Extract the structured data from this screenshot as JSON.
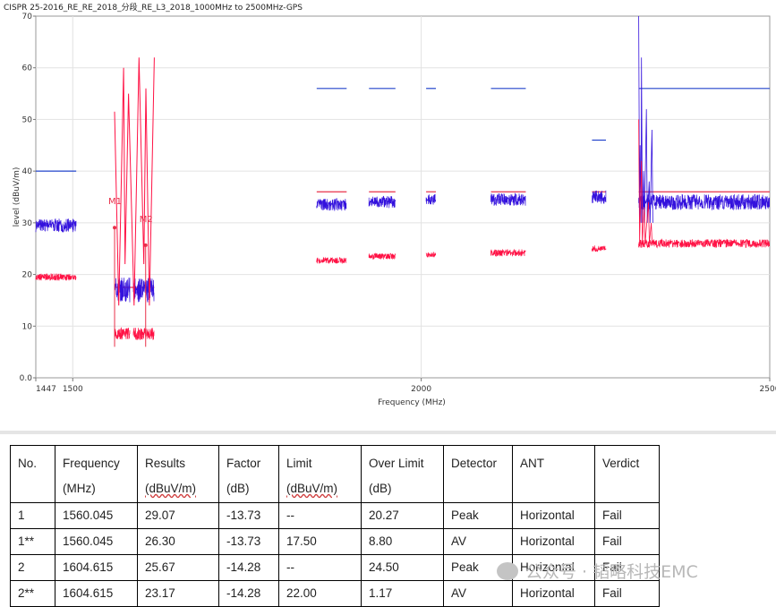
{
  "chart_data": {
    "type": "line",
    "title": "CISPR 25-2016_RE_RE_2018_分段_RE_L3_2018_1000MHz to 2500MHz-GPS",
    "xlabel": "Frequency (MHz)",
    "ylabel": "level (dBuV/m)",
    "xlim": [
      1447,
      2500
    ],
    "ylim": [
      0,
      70
    ],
    "x_ticks": [
      "1447",
      "1500",
      "2000",
      "2500"
    ],
    "y_ticks": [
      "0.0",
      "10",
      "20",
      "30",
      "40",
      "50",
      "60",
      "70"
    ],
    "grid": true,
    "series": [
      {
        "role": "limit-peak",
        "color": "#2244cc",
        "segments": [
          {
            "x": [
              1447,
              1505
            ],
            "y": 40
          },
          {
            "x": [
              1850,
              1893
            ],
            "y": 56
          },
          {
            "x": [
              1925,
              1963
            ],
            "y": 56
          },
          {
            "x": [
              2007,
              2021
            ],
            "y": 56
          },
          {
            "x": [
              2100,
              2150
            ],
            "y": 56
          },
          {
            "x": [
              2245,
              2265
            ],
            "y": 46
          },
          {
            "x": [
              2312,
              2500
            ],
            "y": 56
          }
        ]
      },
      {
        "role": "limit-average",
        "color": "#e8304a",
        "segments": [
          {
            "x": [
              1560,
              1617
            ],
            "y": 17.5
          },
          {
            "x": [
              1850,
              1893
            ],
            "y": 36
          },
          {
            "x": [
              1925,
              1963
            ],
            "y": 36
          },
          {
            "x": [
              2007,
              2021
            ],
            "y": 36
          },
          {
            "x": [
              2100,
              2150
            ],
            "y": 36
          },
          {
            "x": [
              2245,
              2265
            ],
            "y": 36
          },
          {
            "x": [
              2312,
              2500
            ],
            "y": 36
          }
        ]
      },
      {
        "role": "peak-trace",
        "color": "#3311dd",
        "bands": [
          {
            "x": [
              1447,
              1505
            ],
            "level": 29.5,
            "spread": 1.3
          },
          {
            "x": [
              1560,
              1582
            ],
            "level": 17,
            "spread": 2.4
          },
          {
            "x": [
              1587,
              1617
            ],
            "level": 17,
            "spread": 2.4
          },
          {
            "x": [
              1850,
              1893
            ],
            "level": 33.5,
            "spread": 1.2
          },
          {
            "x": [
              1925,
              1963
            ],
            "level": 34,
            "spread": 1.2
          },
          {
            "x": [
              2007,
              2021
            ],
            "level": 34.5,
            "spread": 1
          },
          {
            "x": [
              2100,
              2150
            ],
            "level": 34.5,
            "spread": 1.2
          },
          {
            "x": [
              2245,
              2265
            ],
            "level": 35,
            "spread": 1.3
          },
          {
            "x": [
              2312,
              2500
            ],
            "level": 34,
            "spread": 1.5
          }
        ]
      },
      {
        "role": "average-trace",
        "color": "#ff1144",
        "bands": [
          {
            "x": [
              1447,
              1505
            ],
            "level": 19.5,
            "spread": 0.7
          },
          {
            "x": [
              1560,
              1582
            ],
            "level": 8.5,
            "spread": 1.2
          },
          {
            "x": [
              1587,
              1617
            ],
            "level": 8.5,
            "spread": 1.2
          },
          {
            "x": [
              1850,
              1893
            ],
            "level": 22.7,
            "spread": 0.6
          },
          {
            "x": [
              1925,
              1963
            ],
            "level": 23.5,
            "spread": 0.6
          },
          {
            "x": [
              2007,
              2021
            ],
            "level": 23.8,
            "spread": 0.5
          },
          {
            "x": [
              2100,
              2150
            ],
            "level": 24.2,
            "spread": 0.7
          },
          {
            "x": [
              2245,
              2265
            ],
            "level": 25,
            "spread": 0.6
          },
          {
            "x": [
              2312,
              2500
            ],
            "level": 26,
            "spread": 0.8
          }
        ]
      }
    ],
    "peak_sweeps": {
      "color": "#ff1144",
      "points": [
        [
          1560,
          51.5
        ],
        [
          1566,
          14
        ],
        [
          1573,
          60
        ],
        [
          1575,
          22
        ],
        [
          1580,
          55
        ],
        [
          1588,
          14
        ],
        [
          1595,
          62
        ],
        [
          1602,
          22
        ],
        [
          1605,
          56
        ],
        [
          1610,
          14
        ],
        [
          1617,
          62
        ]
      ]
    },
    "markers": [
      {
        "label": "M1",
        "x": 1560.045,
        "y": 29.07
      },
      {
        "label": "M2",
        "x": 1604.615,
        "y": 25.67
      }
    ]
  },
  "table": {
    "headers": [
      [
        "No.",
        ""
      ],
      [
        "Frequency",
        "(MHz)"
      ],
      [
        "Results",
        "(dBuV/m)"
      ],
      [
        "Factor",
        "(dB)"
      ],
      [
        "Limit",
        "(dBuV/m)"
      ],
      [
        "Over Limit",
        "(dB)"
      ],
      [
        "Detector",
        ""
      ],
      [
        "ANT",
        ""
      ],
      [
        "Verdict",
        ""
      ]
    ],
    "rows": [
      [
        "1",
        "1560.045",
        "29.07",
        "-13.73",
        "--",
        "20.27",
        "Peak",
        "Horizontal",
        "Fail"
      ],
      [
        "1**",
        "1560.045",
        "26.30",
        "-13.73",
        "17.50",
        "8.80",
        "AV",
        "Horizontal",
        "Fail"
      ],
      [
        "2",
        "1604.615",
        "25.67",
        "-14.28",
        "--",
        "24.50",
        "Peak",
        "Horizontal",
        "Fail"
      ],
      [
        "2**",
        "1604.615",
        "23.17",
        "-14.28",
        "22.00",
        "1.17",
        "AV",
        "Horizontal",
        "Fail"
      ]
    ]
  },
  "watermark": "公众号 · 韬略科技EMC"
}
